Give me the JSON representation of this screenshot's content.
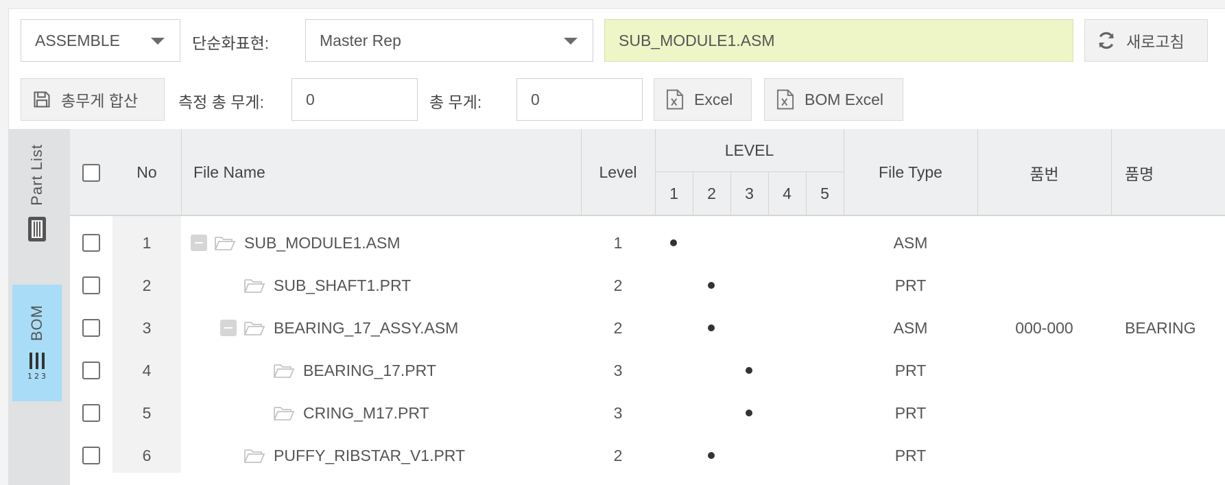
{
  "toolbar": {
    "mode_select": "ASSEMBLE",
    "simplified_rep_label": "단순화표현:",
    "rep_select": "Master Rep",
    "current_file": "SUB_MODULE1.ASM",
    "refresh_label": "새로고침",
    "sum_weight_label": "총무게 합산",
    "measured_weight_label": "측정 총 무게:",
    "measured_weight_value": "0",
    "total_weight_label": "총 무게:",
    "total_weight_value": "0",
    "excel_label": "Excel",
    "bom_excel_label": "BOM Excel"
  },
  "side_tabs": {
    "part_list": "Part  List",
    "bom": "BOM"
  },
  "table": {
    "headers": {
      "no": "No",
      "file_name": "File Name",
      "level": "Level",
      "level_group": "LEVEL",
      "level_cols": [
        "1",
        "2",
        "3",
        "4",
        "5"
      ],
      "file_type": "File Type",
      "part_no": "품번",
      "part_name": "품명"
    },
    "rows": [
      {
        "no": "1",
        "name": "SUB_MODULE1.ASM",
        "level": "1",
        "dot_level": 1,
        "type": "ASM",
        "part_no": "",
        "part_name": "",
        "indent": 0,
        "expandable": true
      },
      {
        "no": "2",
        "name": "SUB_SHAFT1.PRT",
        "level": "2",
        "dot_level": 2,
        "type": "PRT",
        "part_no": "",
        "part_name": "",
        "indent": 1,
        "expandable": false
      },
      {
        "no": "3",
        "name": "BEARING_17_ASSY.ASM",
        "level": "2",
        "dot_level": 2,
        "type": "ASM",
        "part_no": "000-000",
        "part_name": "BEARING",
        "indent": 1,
        "expandable": true
      },
      {
        "no": "4",
        "name": "BEARING_17.PRT",
        "level": "3",
        "dot_level": 3,
        "type": "PRT",
        "part_no": "",
        "part_name": "",
        "indent": 2,
        "expandable": false
      },
      {
        "no": "5",
        "name": "CRING_M17.PRT",
        "level": "3",
        "dot_level": 3,
        "type": "PRT",
        "part_no": "",
        "part_name": "",
        "indent": 2,
        "expandable": false
      },
      {
        "no": "6",
        "name": "PUFFY_RIBSTAR_V1.PRT",
        "level": "2",
        "dot_level": 2,
        "type": "PRT",
        "part_no": "",
        "part_name": "",
        "indent": 1,
        "expandable": false
      }
    ]
  }
}
